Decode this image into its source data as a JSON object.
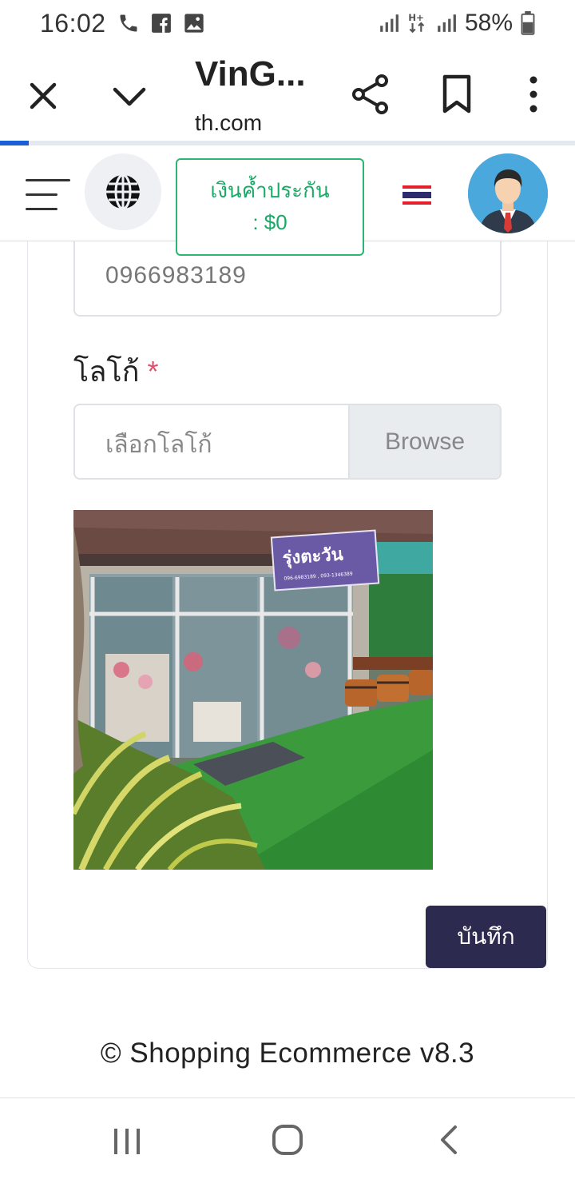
{
  "status_bar": {
    "time": "16:02",
    "battery": "58%",
    "icons": [
      "phone-icon",
      "facebook-icon",
      "gallery-icon",
      "signal-icon",
      "data-icon",
      "signal-icon",
      "battery-icon"
    ]
  },
  "browser": {
    "title": "VinG...",
    "url_faded": "",
    "url": "th.com",
    "load_progress": 0.05,
    "icons": [
      "close-icon",
      "chevron-down-icon",
      "share-icon",
      "bookmark-icon",
      "more-vert-icon"
    ]
  },
  "header": {
    "deposit_line1": "เงินค้ำประกัน",
    "deposit_line2": ": $0",
    "icons": [
      "menu-icon",
      "globe-icon",
      "thai-flag-icon",
      "avatar-icon"
    ],
    "colors": {
      "accent_green": "#2bb673",
      "avatar_bg": "#4aa8dc"
    }
  },
  "form": {
    "phone_value": "0966983189",
    "logo_label": "โลโก้",
    "required_mark": "*",
    "file_placeholder": "เลือกโลโก้",
    "browse_label": "Browse",
    "save_label": "บันทึก",
    "colors": {
      "save_button": "#2c2a4e",
      "required": "#e0506a"
    }
  },
  "preview": {
    "sign_text": "รุ่งตะวัน",
    "sign_sub": "096-6983189 , 093-1346389"
  },
  "footer": {
    "text": "© Shopping Ecommerce v8.3"
  },
  "nav_bar": {
    "icons": [
      "recent-apps-icon",
      "home-icon",
      "back-icon"
    ]
  }
}
